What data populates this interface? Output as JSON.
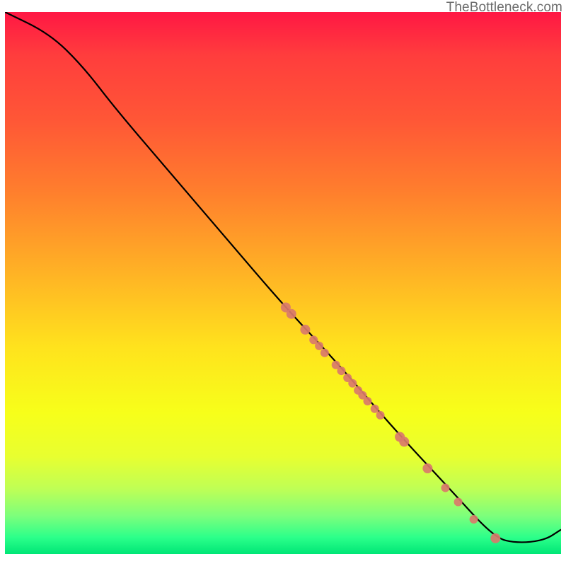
{
  "attribution": "TheBottleneck.com",
  "chart_data": {
    "type": "line",
    "title": "",
    "xlabel": "",
    "ylabel": "",
    "xlim": [
      0,
      100
    ],
    "ylim": [
      0,
      100
    ],
    "curve": [
      {
        "x": 0,
        "y": 100
      },
      {
        "x": 8,
        "y": 96
      },
      {
        "x": 14,
        "y": 90
      },
      {
        "x": 20,
        "y": 82
      },
      {
        "x": 30,
        "y": 70
      },
      {
        "x": 40,
        "y": 58
      },
      {
        "x": 50,
        "y": 46
      },
      {
        "x": 60,
        "y": 35
      },
      {
        "x": 70,
        "y": 23
      },
      {
        "x": 80,
        "y": 12
      },
      {
        "x": 88,
        "y": 3
      },
      {
        "x": 92,
        "y": 2
      },
      {
        "x": 97,
        "y": 2.5
      },
      {
        "x": 100,
        "y": 4.5
      }
    ],
    "markers": [
      {
        "x": 50.5,
        "y": 45.5
      },
      {
        "x": 51.5,
        "y": 44.3
      },
      {
        "x": 54.0,
        "y": 41.4
      },
      {
        "x": 55.5,
        "y": 39.5
      },
      {
        "x": 56.5,
        "y": 38.4
      },
      {
        "x": 57.5,
        "y": 37.1
      },
      {
        "x": 59.5,
        "y": 34.9
      },
      {
        "x": 60.5,
        "y": 33.8
      },
      {
        "x": 61.6,
        "y": 32.5
      },
      {
        "x": 62.5,
        "y": 31.5
      },
      {
        "x": 63.5,
        "y": 30.2
      },
      {
        "x": 64.3,
        "y": 29.3
      },
      {
        "x": 65.2,
        "y": 28.2
      },
      {
        "x": 66.5,
        "y": 26.8
      },
      {
        "x": 67.5,
        "y": 25.6
      },
      {
        "x": 71.0,
        "y": 21.6
      },
      {
        "x": 71.8,
        "y": 20.7
      },
      {
        "x": 76.0,
        "y": 15.8
      },
      {
        "x": 79.2,
        "y": 12.2
      },
      {
        "x": 81.5,
        "y": 9.6
      },
      {
        "x": 84.3,
        "y": 6.4
      },
      {
        "x": 88.2,
        "y": 2.9
      }
    ],
    "marker_radius_small": 5,
    "marker_radius_large": 7,
    "marker_color": "#d9796b",
    "curve_color": "#000000",
    "gradient_stops": [
      {
        "pos": 0.0,
        "color": "#ff1744"
      },
      {
        "pos": 0.5,
        "color": "#ffe31d"
      },
      {
        "pos": 1.0,
        "color": "#00e676"
      }
    ]
  }
}
